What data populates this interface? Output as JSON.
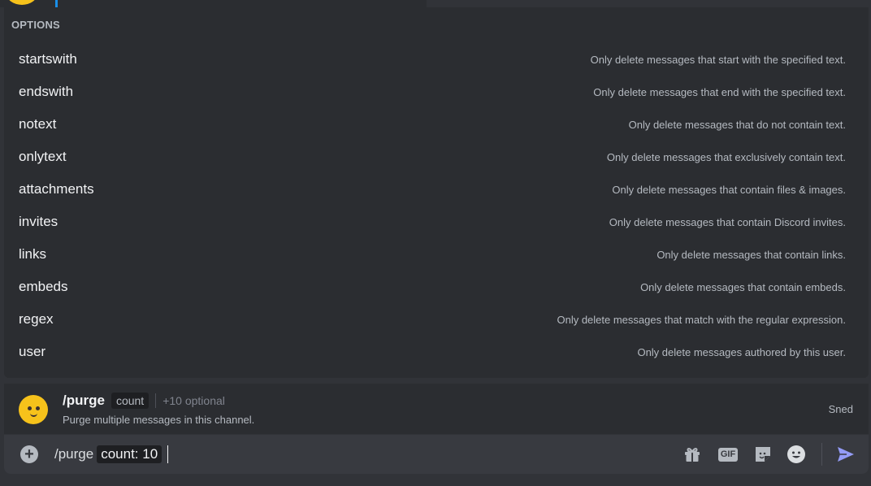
{
  "options": {
    "header": "OPTIONS",
    "items": [
      {
        "name": "startswith",
        "description": "Only delete messages that start with the specified text."
      },
      {
        "name": "endswith",
        "description": "Only delete messages that end with the specified text."
      },
      {
        "name": "notext",
        "description": "Only delete messages that do not contain text."
      },
      {
        "name": "onlytext",
        "description": "Only delete messages that exclusively contain text."
      },
      {
        "name": "attachments",
        "description": "Only delete messages that contain files & images."
      },
      {
        "name": "invites",
        "description": "Only delete messages that contain Discord invites."
      },
      {
        "name": "links",
        "description": "Only delete messages that contain links."
      },
      {
        "name": "embeds",
        "description": "Only delete messages that contain embeds."
      },
      {
        "name": "regex",
        "description": "Only delete messages that match with the regular expression."
      },
      {
        "name": "user",
        "description": "Only delete messages authored by this user."
      }
    ]
  },
  "command": {
    "name": "/purge",
    "required_param": "count",
    "optional_text": "+10 optional",
    "description": "Purge multiple messages in this channel.",
    "source": "Sned"
  },
  "input": {
    "command": "/purge",
    "param_value": "count: 10"
  },
  "colors": {
    "panel": "#2b2d31",
    "input": "#383a40",
    "accent_send": "#949cf7",
    "avatar": "#f6c21b"
  }
}
